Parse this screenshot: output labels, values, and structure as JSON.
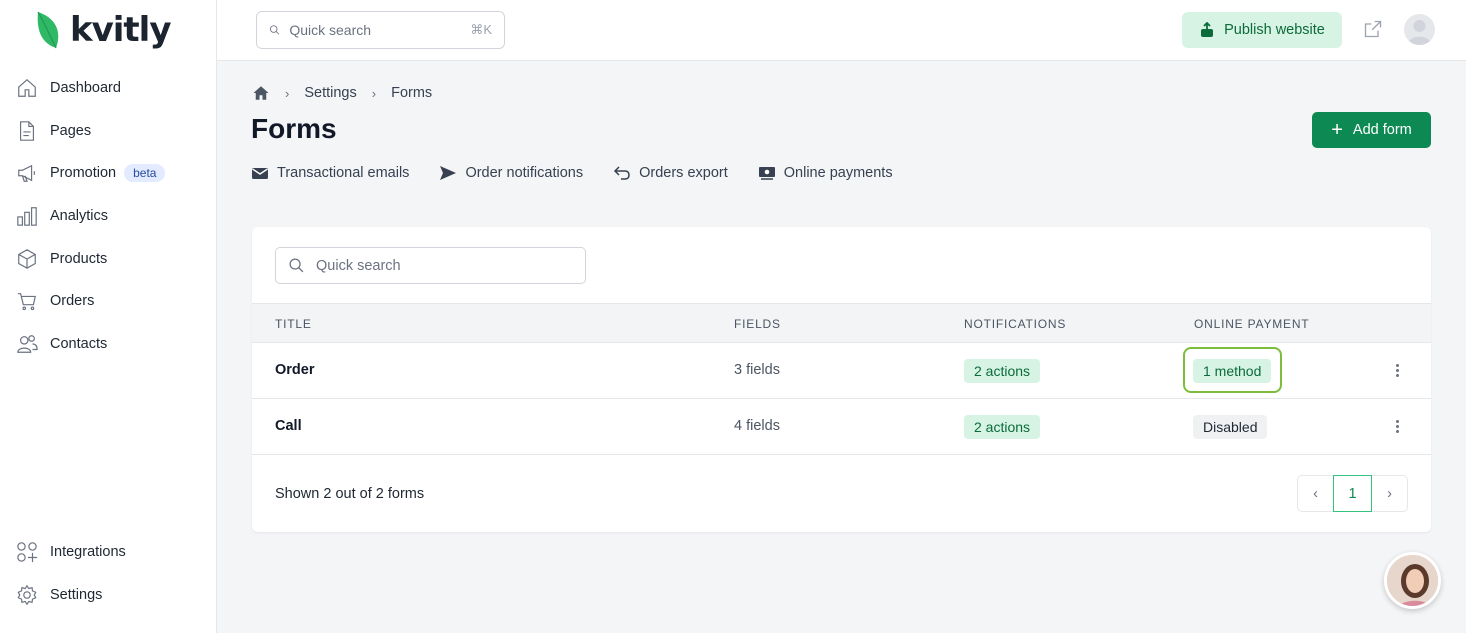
{
  "brand": {
    "name": "kvitly",
    "accent": "#0d8a53",
    "leaf_color": "#2fb865"
  },
  "sidebar": {
    "items": [
      {
        "label": "Dashboard",
        "icon": "home-icon"
      },
      {
        "label": "Pages",
        "icon": "page-icon"
      },
      {
        "label": "Promotion",
        "icon": "megaphone-icon",
        "badge": "beta"
      },
      {
        "label": "Analytics",
        "icon": "bar-chart-icon"
      },
      {
        "label": "Products",
        "icon": "box-icon"
      },
      {
        "label": "Orders",
        "icon": "cart-icon"
      },
      {
        "label": "Contacts",
        "icon": "users-icon"
      }
    ],
    "bottom_items": [
      {
        "label": "Integrations",
        "icon": "grid-plus-icon"
      },
      {
        "label": "Settings",
        "icon": "gear-icon"
      }
    ]
  },
  "header": {
    "search_placeholder": "Quick search",
    "search_shortcut": "⌘K",
    "publish_label": "Publish website"
  },
  "breadcrumb": {
    "items": [
      "Settings",
      "Forms"
    ]
  },
  "page": {
    "title": "Forms",
    "add_button": "Add form",
    "tabs": [
      {
        "label": "Transactional emails",
        "icon": "envelope-icon"
      },
      {
        "label": "Order notifications",
        "icon": "send-icon"
      },
      {
        "label": "Orders export",
        "icon": "undo-arrow-icon"
      },
      {
        "label": "Online payments",
        "icon": "cash-icon"
      }
    ]
  },
  "table": {
    "search_placeholder": "Quick search",
    "columns": [
      "TITLE",
      "FIELDS",
      "NOTIFICATIONS",
      "ONLINE PAYMENT"
    ],
    "rows": [
      {
        "title": "Order",
        "fields": "3 fields",
        "notifications": "2 actions",
        "payment": "1 method"
      },
      {
        "title": "Call",
        "fields": "4 fields",
        "notifications": "2 actions",
        "payment": "Disabled"
      }
    ],
    "footer": "Shown 2 out of 2 forms",
    "pager": {
      "current": "1"
    }
  }
}
